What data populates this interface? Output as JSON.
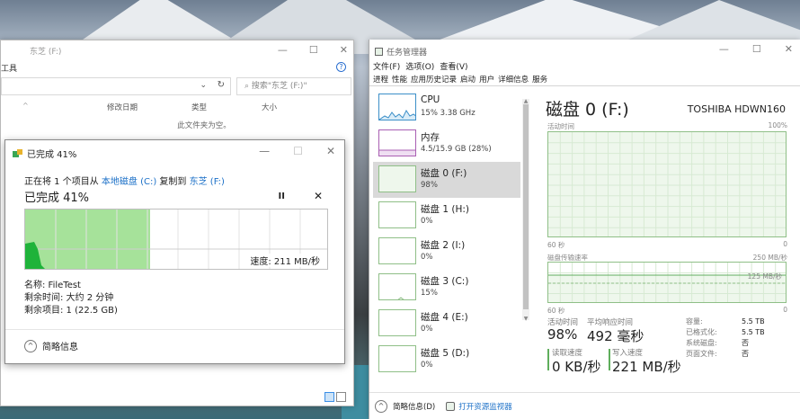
{
  "explorer": {
    "title": "东芝 (F:)",
    "ribbon_label": "工具",
    "search_placeholder": "搜索\"东芝 (F:)\"",
    "columns": [
      "修改日期",
      "类型",
      "大小"
    ],
    "empty_text": "此文件夹为空。",
    "help": "?",
    "refresh": "↻",
    "dropdown": "⌄",
    "min": "—",
    "max": "☐",
    "close": "✕",
    "sort": "^"
  },
  "copy_dialog": {
    "title": "已完成 41%",
    "line_prefix": "正在将 1 个项目从 ",
    "source": "本地磁盘 (C:)",
    "line_mid": " 复制到 ",
    "dest": "东芝 (F:)",
    "percent_label": "已完成 41%",
    "progress_fraction": 0.41,
    "pause": "II",
    "cancel": "✕",
    "speed": "速度: 211 MB/秒",
    "name_line": "名称: FileTest",
    "time_line": "剩余时间: 大约 2 分钟",
    "items_line": "剩余项目: 1 (22.5 GB)",
    "brief_label": "简略信息",
    "brief_icon": "^",
    "min": "—",
    "max": "☐",
    "close": "✕"
  },
  "task_manager": {
    "title": "任务管理器",
    "menu": [
      "文件(F)",
      "选项(O)",
      "查看(V)"
    ],
    "tabs": [
      "进程",
      "性能",
      "应用历史记录",
      "启动",
      "用户",
      "详细信息",
      "服务"
    ],
    "active_tab": "性能",
    "sidebar": [
      {
        "name": "CPU",
        "value": "15%  3.38 GHz",
        "kind": "cpu"
      },
      {
        "name": "内存",
        "value": "4.5/15.9 GB (28%)",
        "kind": "mem"
      },
      {
        "name": "磁盘 0 (F:)",
        "value": "98%",
        "kind": "disk",
        "selected": true
      },
      {
        "name": "磁盘 1 (H:)",
        "value": "0%",
        "kind": "disk"
      },
      {
        "name": "磁盘 2 (I:)",
        "value": "0%",
        "kind": "disk"
      },
      {
        "name": "磁盘 3 (C:)",
        "value": "15%",
        "kind": "disk"
      },
      {
        "name": "磁盘 4 (E:)",
        "value": "0%",
        "kind": "disk"
      },
      {
        "name": "磁盘 5 (D:)",
        "value": "0%",
        "kind": "disk"
      }
    ],
    "disk_title": "磁盘 0 (F:)",
    "disk_model": "TOSHIBA HDWN160",
    "chart1_label": "活动时间",
    "chart1_max": "100%",
    "chart1_time": "60 秒",
    "chart1_zero": "0",
    "chart2_label": "磁盘传输速率",
    "chart2_max": "250 MB/秒",
    "chart2_mid": "125 MB/秒",
    "chart2_time": "60 秒",
    "chart2_zero": "0",
    "stats": {
      "active_time_label": "活动时间",
      "active_time": "98%",
      "avg_response_label": "平均响应时间",
      "avg_response": "492 毫秒",
      "read_label": "读取速度",
      "read": "0 KB/秒",
      "write_label": "写入速度",
      "write": "221 MB/秒"
    },
    "props": [
      {
        "k": "容量:",
        "v": "5.5 TB"
      },
      {
        "k": "已格式化:",
        "v": "5.5 TB"
      },
      {
        "k": "系统磁盘:",
        "v": "否"
      },
      {
        "k": "页面文件:",
        "v": "否"
      }
    ],
    "footer_brief": "简略信息(D)",
    "footer_monitor": "打开资源监视器",
    "min": "—",
    "max": "☐",
    "close": "✕"
  },
  "colors": {
    "progress_green": "#a6e29a",
    "disk_green": "#8fbf87",
    "link_blue": "#1a6fc7",
    "chart_fill": "#eef7ec"
  }
}
